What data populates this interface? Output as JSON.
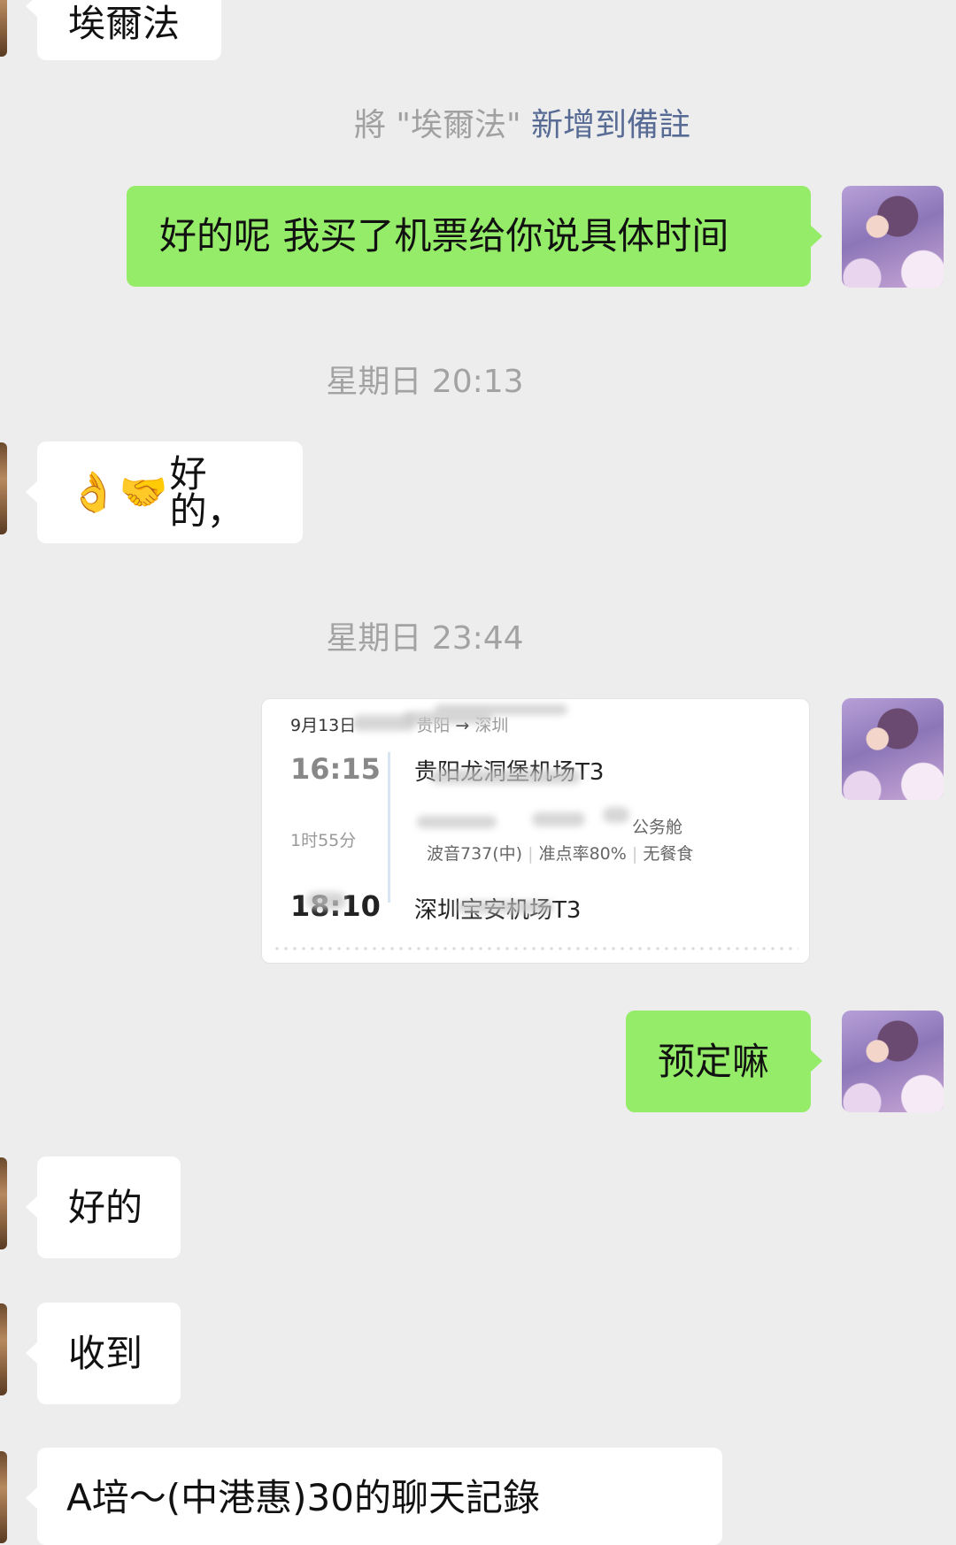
{
  "messages": {
    "msg0": "埃爾法",
    "msg1": "好的呢 我买了机票给你说具体时间",
    "msg2_emoji1": "👌",
    "msg2_emoji2": "🤝",
    "msg2_text": "好的，",
    "msg3": "预定嘛",
    "msg4": "好的",
    "msg5": "收到",
    "msg6": "A培～(中港惠)30的聊天記錄"
  },
  "system_note": {
    "prefix": "將 \"埃爾法\" ",
    "link": "新增到備註"
  },
  "timestamps": {
    "t1": "星期日 20:13",
    "t2": "星期日 23:44"
  },
  "flight_card": {
    "date": "9月13日",
    "route_from": "贵阳",
    "route_arrow": "→",
    "route_to": "深圳",
    "depart_time": "16:15",
    "depart_airport": "贵阳龙洞堡机场T3",
    "duration": "1时55分",
    "cabin": "公务舱",
    "aircraft": "波音737(中)",
    "on_time_rate": "准点率80%",
    "meal": "无餐食",
    "separator": "|",
    "arrive_time": "18:10",
    "arrive_airport": "深圳宝安机场T3"
  },
  "colors": {
    "background": "#ededed",
    "outgoing_bubble": "#95ec69",
    "incoming_bubble": "#ffffff",
    "link": "#576b95"
  },
  "icons": {
    "self_avatar": "user-avatar",
    "contact_avatar": "contact-avatar"
  }
}
